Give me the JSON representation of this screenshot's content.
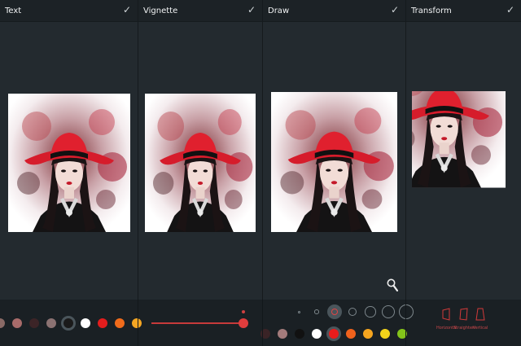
{
  "panels": [
    {
      "title": "Text",
      "check": "✓"
    },
    {
      "title": "Vignette",
      "check": "✓"
    },
    {
      "title": "Draw",
      "check": "✓"
    },
    {
      "title": "Transform",
      "check": "✓"
    }
  ],
  "text_palette": {
    "colors": [
      "#8a6a66",
      "#a86b6a",
      "#3c2427",
      "#8b7272",
      "#1a1a1a",
      "#ffffff",
      "#e31d1d",
      "#f06b1b",
      "#f5a623"
    ],
    "selected_index": 4
  },
  "vignette": {
    "level": 1.0
  },
  "draw": {
    "brush_sizes_count": 7,
    "selected_brush_index": 2,
    "palette": {
      "colors": [
        "#3a2326",
        "#a37b7b",
        "#111111",
        "#ffffff",
        "#e81c1c",
        "#f0621c",
        "#f5a51f",
        "#f2d31a",
        "#84c41a"
      ],
      "selected_index": 4
    },
    "zoom_icon": "magnifier-icon"
  },
  "transform": {
    "tools": [
      {
        "label": "Horizontal",
        "icon": "horizontal-perspective-icon"
      },
      {
        "label": "Straighten",
        "icon": "straighten-icon"
      },
      {
        "label": "Vertical",
        "icon": "vertical-perspective-icon"
      }
    ],
    "accent": "#d23a3a"
  }
}
